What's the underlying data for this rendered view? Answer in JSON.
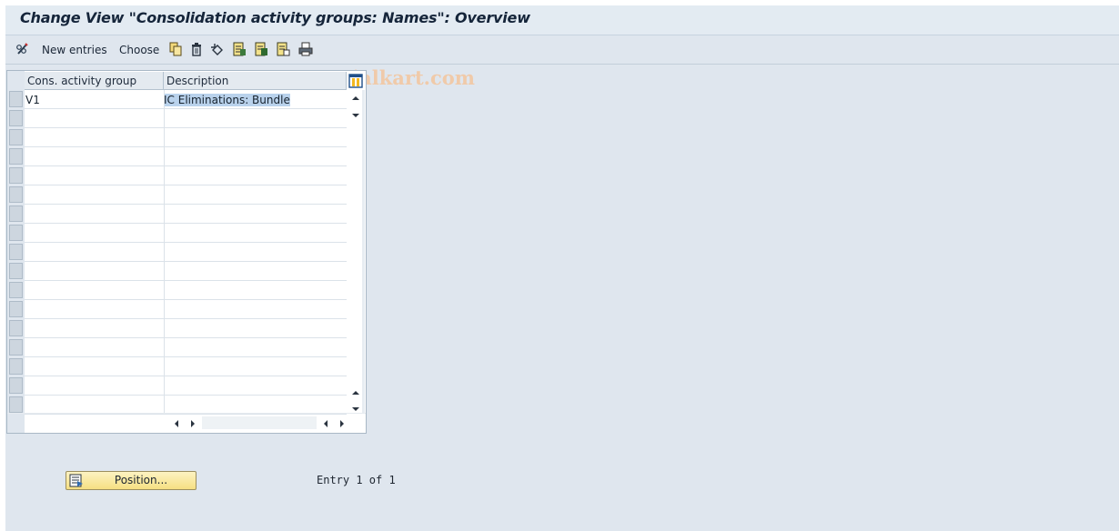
{
  "window": {
    "title": "Change View \"Consolidation activity groups: Names\": Overview"
  },
  "toolbar": {
    "edit_icon": "pencil-glasses-icon",
    "new_entries_label": "New entries",
    "choose_label": "Choose",
    "icons": [
      "copy-icon",
      "delete-icon",
      "undo-icon",
      "select-all-icon",
      "select-block-icon",
      "deselect-all-icon",
      "print-icon"
    ],
    "watermark": "www.tutorialkart.com"
  },
  "table": {
    "columns": [
      "Cons. activity group",
      "Description"
    ],
    "config_icon": "table-settings-icon",
    "rows": [
      {
        "group": "V1",
        "description": "IC Eliminations:  Bundle"
      }
    ],
    "empty_rows": 16,
    "selected_cell_color": "#b9d2ec"
  },
  "footer": {
    "position_button_label": "Position...",
    "position_icon": "position-icon",
    "entry_text": "Entry 1 of 1"
  },
  "colors": {
    "background": "#dfe6ee",
    "button_gold": "#f6df82",
    "title_text": "#15253a"
  }
}
